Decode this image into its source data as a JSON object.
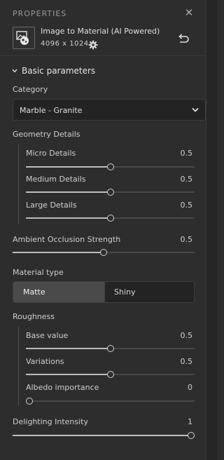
{
  "header": {
    "title": "PROPERTIES",
    "close_glyph": "✕",
    "item_name": "Image to Material (AI Powered)",
    "resolution": "4096 x 1024",
    "icons": {
      "thumbnail": "image-material-thumbnail-icon",
      "settings": "gear-icon",
      "reset": "reset-icon",
      "close": "close-icon"
    }
  },
  "section": {
    "title": "Basic parameters",
    "expanded": true
  },
  "category": {
    "label": "Category",
    "selected": "Marble - Granite"
  },
  "geometry": {
    "label": "Geometry Details",
    "items": [
      {
        "label": "Micro Details",
        "value": "0.5",
        "fraction": 0.5
      },
      {
        "label": "Medium Details",
        "value": "0.5",
        "fraction": 0.5
      },
      {
        "label": "Large Details",
        "value": "0.5",
        "fraction": 0.5
      }
    ]
  },
  "ambient_occlusion": {
    "label": "Ambient Occlusion Strength",
    "value": "0.5",
    "fraction": 0.5
  },
  "material_type": {
    "label": "Material type",
    "options": [
      "Matte",
      "Shiny"
    ],
    "selected": "Matte"
  },
  "roughness": {
    "label": "Roughness",
    "items": [
      {
        "label": "Base value",
        "value": "0.5",
        "fraction": 0.5
      },
      {
        "label": "Variations",
        "value": "0.5",
        "fraction": 0.5
      },
      {
        "label": "Albedo importance",
        "value": "0",
        "fraction": 0.0
      }
    ]
  },
  "delighting": {
    "label": "Delighting Intensity",
    "value": "1",
    "fraction": 1.0
  },
  "colors": {
    "panel_bg": "#2d2d2d",
    "input_bg": "#232323",
    "selected_option_bg": "#4a4a4a",
    "text": "#d4d4d4"
  }
}
